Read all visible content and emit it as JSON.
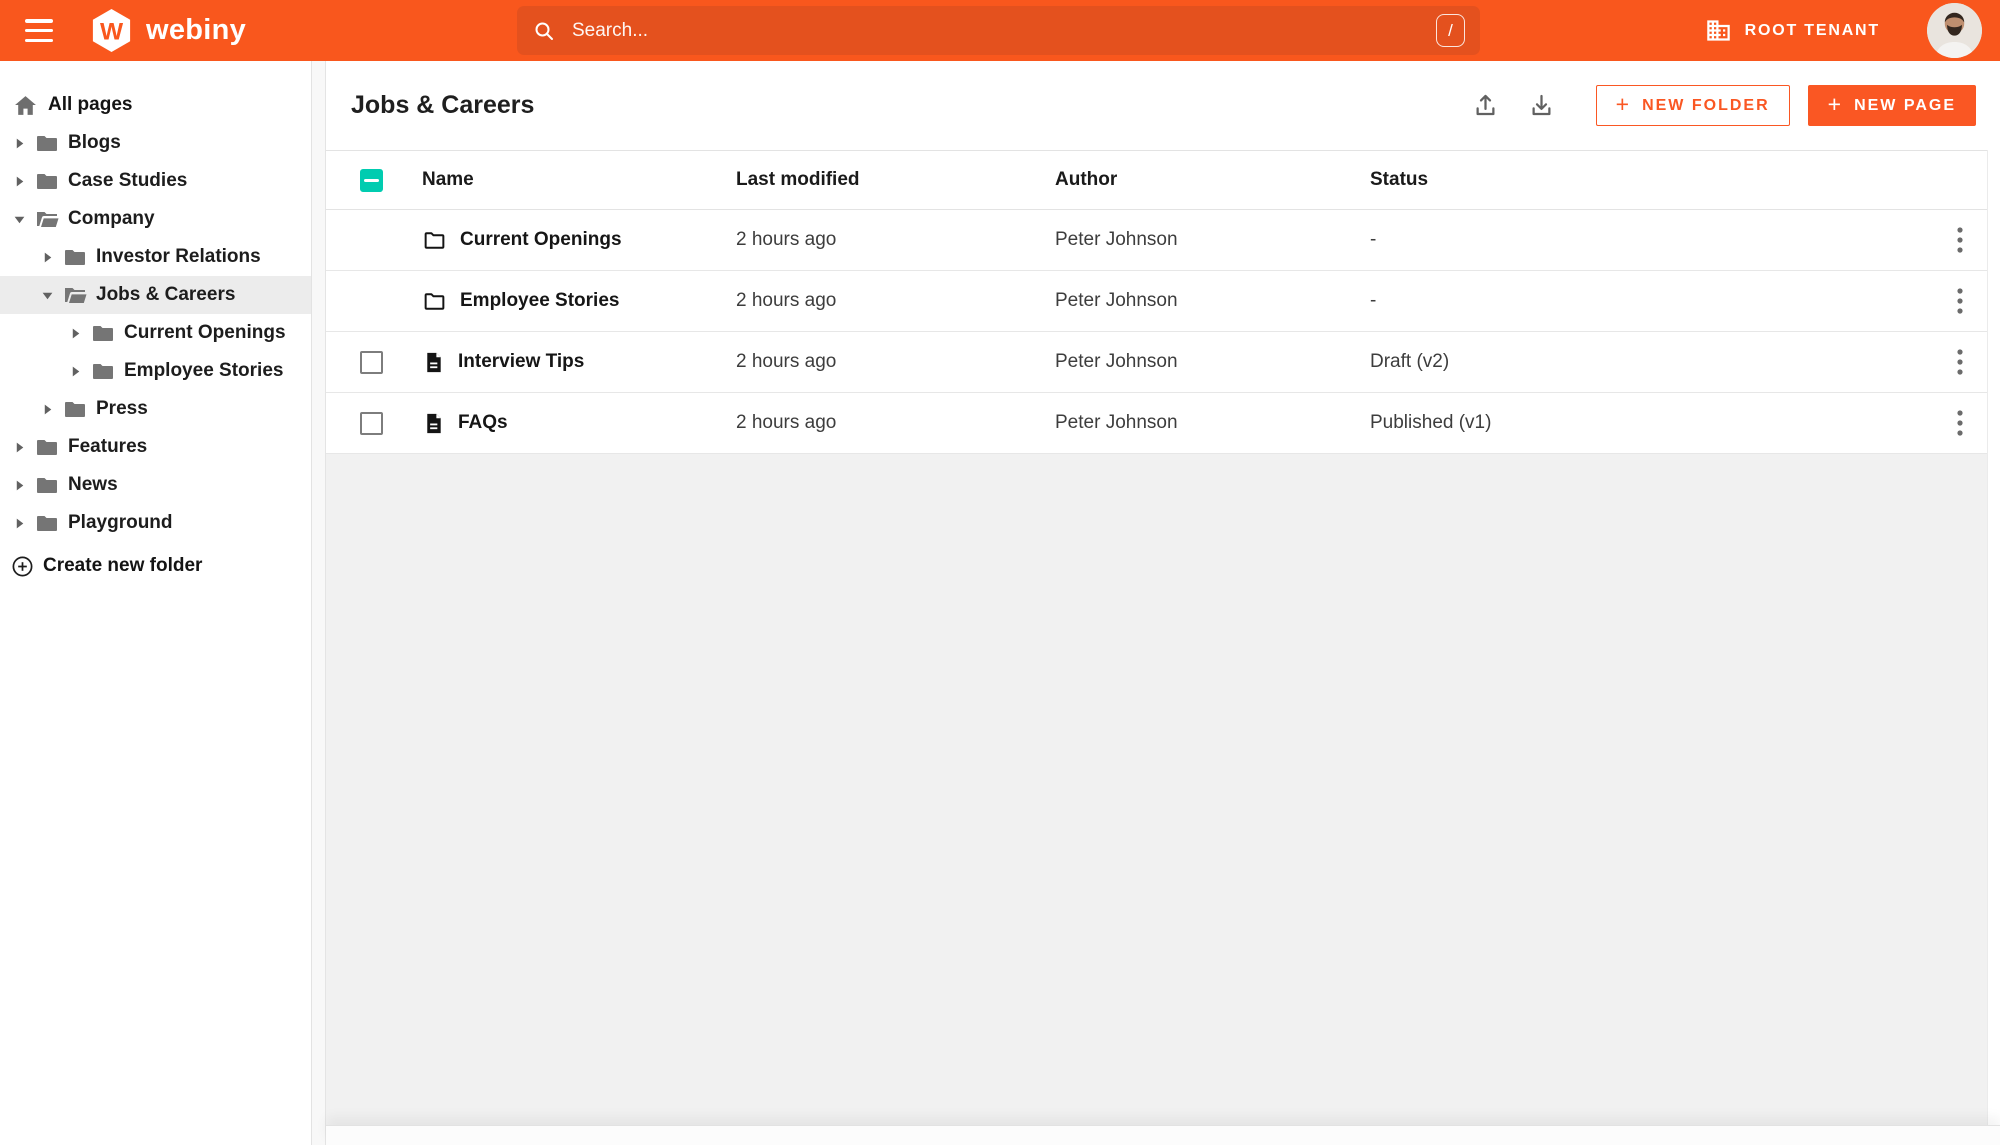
{
  "colors": {
    "topbar": "#F9571D",
    "search_bg": "#E4511E",
    "accent": "#FA5723",
    "checkbox_teal": "#00CCB0",
    "selected_gray": "#ECECEC"
  },
  "topbar": {
    "brand": "webiny",
    "brand_mark": "W",
    "search_placeholder": "Search...",
    "shortcut_key": "/",
    "tenant_label": "ROOT TENANT"
  },
  "sidebar": {
    "all_pages_label": "All pages",
    "create_folder_label": "Create new folder",
    "items": [
      {
        "label": "Blogs",
        "level": 0,
        "expanded": false,
        "selected": false
      },
      {
        "label": "Case Studies",
        "level": 0,
        "expanded": false,
        "selected": false
      },
      {
        "label": "Company",
        "level": 0,
        "expanded": true,
        "selected": false
      },
      {
        "label": "Investor Relations",
        "level": 1,
        "expanded": false,
        "selected": false
      },
      {
        "label": "Jobs & Careers",
        "level": 1,
        "expanded": true,
        "selected": true
      },
      {
        "label": "Current Openings",
        "level": 2,
        "expanded": false,
        "selected": false
      },
      {
        "label": "Employee Stories",
        "level": 2,
        "expanded": false,
        "selected": false
      },
      {
        "label": "Press",
        "level": 1,
        "expanded": false,
        "selected": false
      },
      {
        "label": "Features",
        "level": 0,
        "expanded": false,
        "selected": false
      },
      {
        "label": "News",
        "level": 0,
        "expanded": false,
        "selected": false
      },
      {
        "label": "Playground",
        "level": 0,
        "expanded": false,
        "selected": false
      }
    ]
  },
  "content": {
    "title": "Jobs & Careers",
    "actions": {
      "new_folder": "NEW FOLDER",
      "new_page": "NEW PAGE",
      "plus": "+"
    },
    "table": {
      "header_checkbox_state": "indeterminate",
      "columns": [
        "Name",
        "Last modified",
        "Author",
        "Status"
      ],
      "rows": [
        {
          "name": "Current Openings",
          "icon": "folder",
          "last_modified": "2 hours ago",
          "author": "Peter Johnson",
          "status": "-",
          "has_checkbox": false,
          "checked": false
        },
        {
          "name": "Employee Stories",
          "icon": "folder",
          "last_modified": "2 hours ago",
          "author": "Peter Johnson",
          "status": "-",
          "has_checkbox": false,
          "checked": false
        },
        {
          "name": "Interview Tips",
          "icon": "page",
          "last_modified": "2 hours ago",
          "author": "Peter Johnson",
          "status": "Draft (v2)",
          "has_checkbox": true,
          "checked": false
        },
        {
          "name": "FAQs",
          "icon": "page",
          "last_modified": "2 hours ago",
          "author": "Peter Johnson",
          "status": "Published (v1)",
          "has_checkbox": true,
          "checked": false
        }
      ]
    }
  }
}
